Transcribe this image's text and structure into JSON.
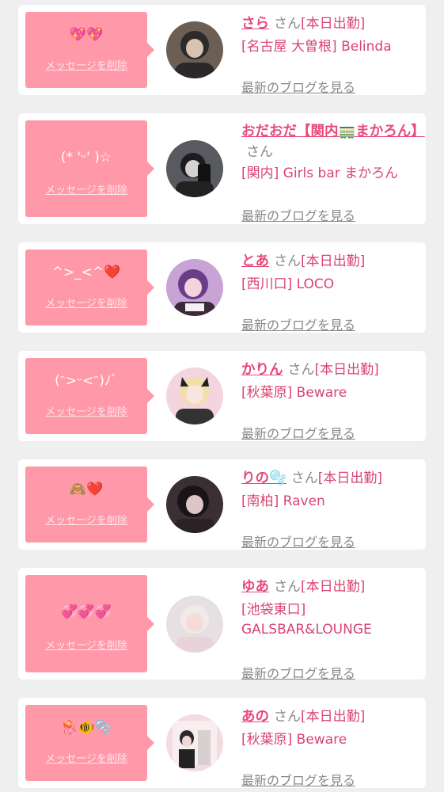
{
  "delete_label": "メッセージを削除",
  "san_label": "さん",
  "blog_label": "最新のブログを見る",
  "colors": {
    "bubble": "#ff98a9",
    "name": "#e84a7a",
    "shop": "#d94470",
    "link_gray": "#888888"
  },
  "cards": [
    {
      "message": "💖💖",
      "name": "さら",
      "status": "[本日出勤]",
      "shop": "[名古屋 大曽根] Belinda"
    },
    {
      "message": "(* 'ᵕ' )☆",
      "name": "おだおだ【関内🚃まかろん】",
      "status": "",
      "shop": "[関内] Girls bar まかろん"
    },
    {
      "message": "^>_<^❤️",
      "name": "とあ",
      "status": "[本日出勤]",
      "shop": "[西川口] LOCO"
    },
    {
      "message": "(ᵔ>ᵕ<ᵔ)ﾉﾞ",
      "name": "かりん",
      "status": "[本日出勤]",
      "shop": "[秋葉原] Beware"
    },
    {
      "message": "🙈❤️",
      "name": "りの🫧",
      "status": "[本日出勤]",
      "shop": "[南柏] Raven"
    },
    {
      "message": "💞💞💞",
      "name": "ゆあ",
      "status": "[本日出勤]",
      "shop": "[池袋東口] GALSBAR&LOUNGE"
    },
    {
      "message": "🪼🐠🫧",
      "name": "あの",
      "status": "[本日出勤]",
      "shop": "[秋葉原] Beware"
    }
  ]
}
